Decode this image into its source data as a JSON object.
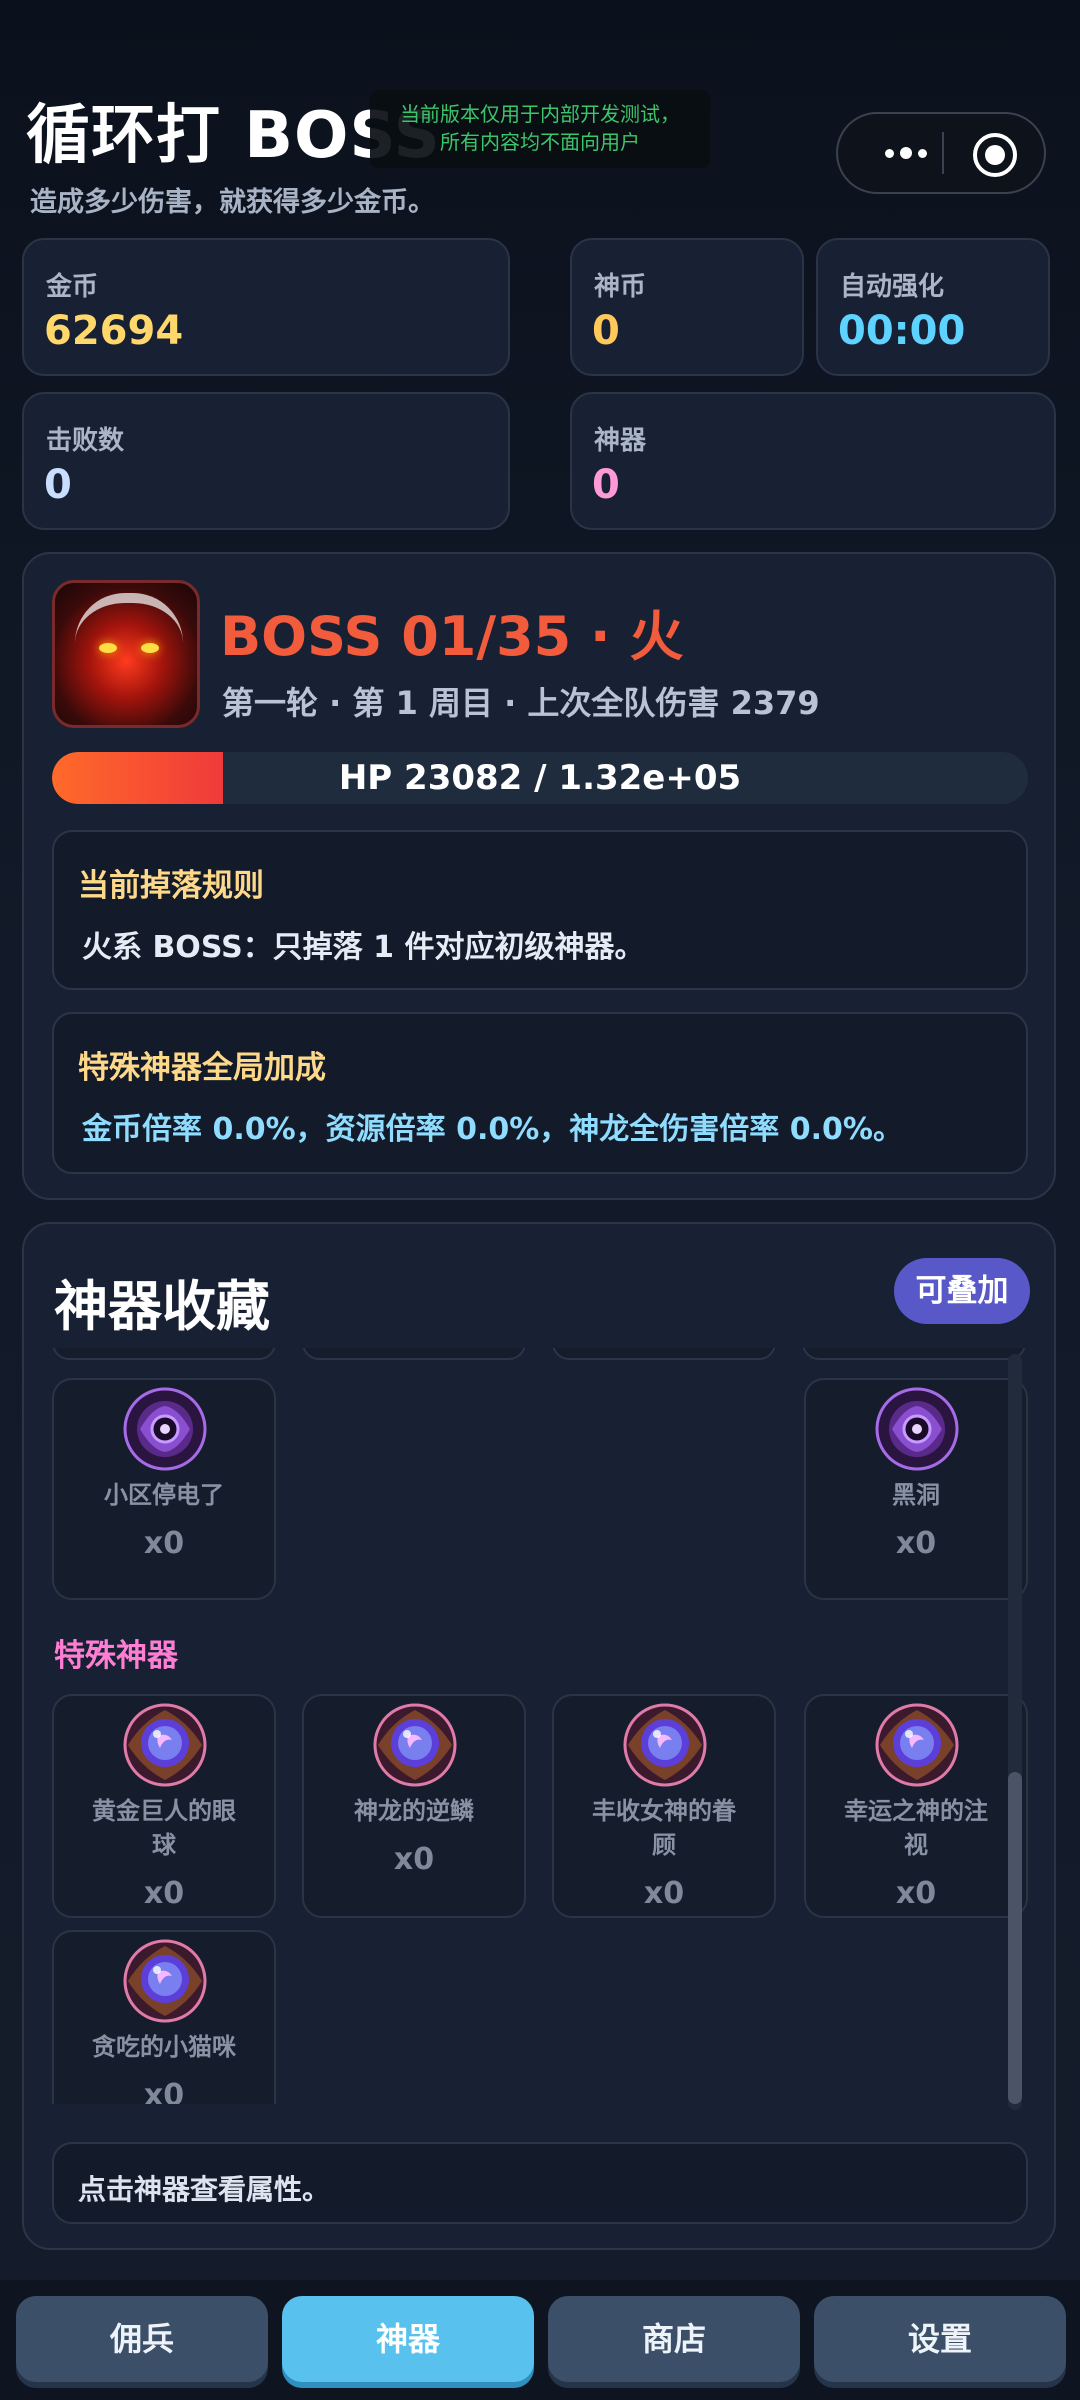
{
  "header": {
    "title": "循环打 BOSS",
    "subtitle": "造成多少伤害，就获得多少金币。",
    "dev_notice_line1": "当前版本仅用于内部开发测试，",
    "dev_notice_line2": "所有内容均不面向用户"
  },
  "stats": {
    "gold": {
      "label": "金币",
      "value": "62694",
      "color": "#ffd76a"
    },
    "godcoin": {
      "label": "神币",
      "value": "0",
      "color": "#ffc85a"
    },
    "auto_upgrade": {
      "label": "自动强化",
      "value": "00:00",
      "color": "#5fd3ff"
    },
    "defeats": {
      "label": "击败数",
      "value": "0",
      "color": "#c9ddff"
    },
    "artifacts": {
      "label": "神器",
      "value": "0",
      "color": "#ff9ad8"
    }
  },
  "boss": {
    "title": "BOSS 01/35 · 火",
    "subtitle": "第一轮 · 第 1 周目 · 上次全队伤害 2379",
    "hp_text": "HP 23082 / 1.32e+05",
    "hp_fraction": 0.175,
    "drop_rule": {
      "title": "当前掉落规则",
      "text": "火系 BOSS：只掉落 1 件对应初级神器。",
      "title_color": "#ffd98a"
    },
    "global_bonus": {
      "title": "特殊神器全局加成",
      "text": "金币倍率 0.0%，资源倍率 0.0%，神龙全伤害倍率 0.0%。",
      "title_color": "#ffd98a",
      "text_color": "#8fdcff"
    }
  },
  "collection": {
    "title": "神器收藏",
    "stack_button": "可叠加",
    "dark_items": [
      {
        "name": "小区停电了",
        "count": "x0",
        "icon": "dark-eye-icon"
      },
      {
        "name": "黑洞",
        "count": "x0",
        "icon": "dark-eye-icon"
      }
    ],
    "special_section": "特殊神器",
    "special_items": [
      {
        "name_line1": "黄金巨人的眼",
        "name_line2": "球",
        "count": "x0",
        "icon": "crystal-orb-icon"
      },
      {
        "name_line1": "神龙的逆鳞",
        "name_line2": "",
        "count": "x0",
        "icon": "crystal-orb-icon"
      },
      {
        "name_line1": "丰收女神的眷",
        "name_line2": "顾",
        "count": "x0",
        "icon": "crystal-orb-icon"
      },
      {
        "name_line1": "幸运之神的注",
        "name_line2": "视",
        "count": "x0",
        "icon": "crystal-orb-icon"
      },
      {
        "name_line1": "贪吃的小猫咪",
        "name_line2": "",
        "count": "x0",
        "icon": "crystal-orb-icon"
      }
    ],
    "hint": "点击神器查看属性。"
  },
  "nav": {
    "tabs": [
      {
        "label": "佣兵",
        "active": false
      },
      {
        "label": "神器",
        "active": true
      },
      {
        "label": "商店",
        "active": false
      },
      {
        "label": "设置",
        "active": false
      }
    ]
  }
}
